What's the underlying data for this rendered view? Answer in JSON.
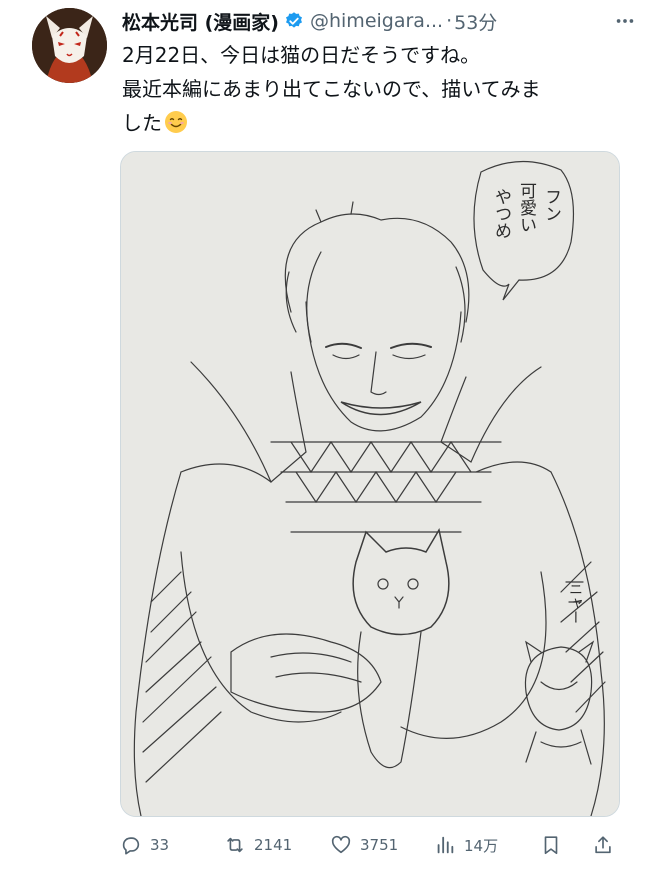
{
  "author": {
    "display_name": "松本光司 (漫画家)",
    "handle": "@himeigara...",
    "separator": "·",
    "time": "53分",
    "verified_color": "#1d9bf0",
    "avatar_icon": "fox-mask-avatar"
  },
  "tweet": {
    "lines": [
      "2月22日、今日は猫の日だそうですね。",
      "最近本編にあまり出てこないので、描いてみま",
      "した"
    ],
    "emoji": "smiling-face-emoji"
  },
  "media": {
    "speech_bubble_lines": [
      "フン",
      "可愛い",
      "やつめ"
    ],
    "small_caption": "ニャー"
  },
  "actions": {
    "replies": "33",
    "retweets": "2141",
    "likes": "3751",
    "views": "14万"
  }
}
